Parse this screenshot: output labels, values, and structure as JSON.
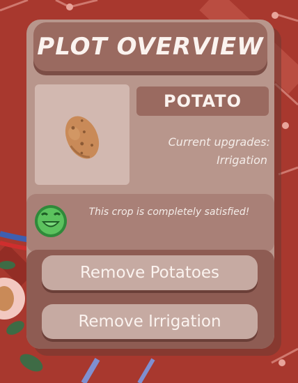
{
  "panel": {
    "title": "PLOT OVERVIEW",
    "crop_name": "POTATO",
    "crop_icon": "potato-icon",
    "upgrades_label": "Current upgrades:",
    "upgrades_value": "Irrigation",
    "status_icon": "happy-face-icon",
    "status_text": "This crop is completely satisfied!"
  },
  "actions": {
    "remove_crop_label": "Remove Potatoes",
    "remove_upgrade_label": "Remove Irrigation"
  },
  "colors": {
    "panel": "#b8968c",
    "title_bar": "#9a6a60",
    "button": "#c6aaa2",
    "status_green": "#4caf50",
    "background": "#a8382e"
  }
}
